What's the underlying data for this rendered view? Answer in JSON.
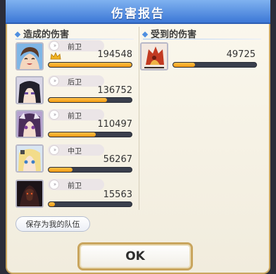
{
  "dialog": {
    "title": "伤害报告"
  },
  "dealt": {
    "header": "造成的伤害",
    "rows": [
      {
        "position": "前卫",
        "value": "194548",
        "fill": 1.0,
        "crown": true
      },
      {
        "position": "后卫",
        "value": "136752",
        "fill": 0.7,
        "crown": false
      },
      {
        "position": "前卫",
        "value": "110497",
        "fill": 0.57,
        "crown": false
      },
      {
        "position": "中卫",
        "value": "56267",
        "fill": 0.29,
        "crown": false
      },
      {
        "position": "前卫",
        "value": "15563",
        "fill": 0.08,
        "crown": false
      }
    ]
  },
  "received": {
    "header": "受到的伤害",
    "rows": [
      {
        "value": "49725",
        "fill": 0.26
      }
    ]
  },
  "buttons": {
    "save_label": "保存为我的队伍",
    "ok_label": "OK"
  },
  "colors": {
    "title_bar": "#3d78d6",
    "bar_fill": "#f29a12",
    "bar_track": "#3a3f4d",
    "border_gold": "#c9a55d"
  }
}
